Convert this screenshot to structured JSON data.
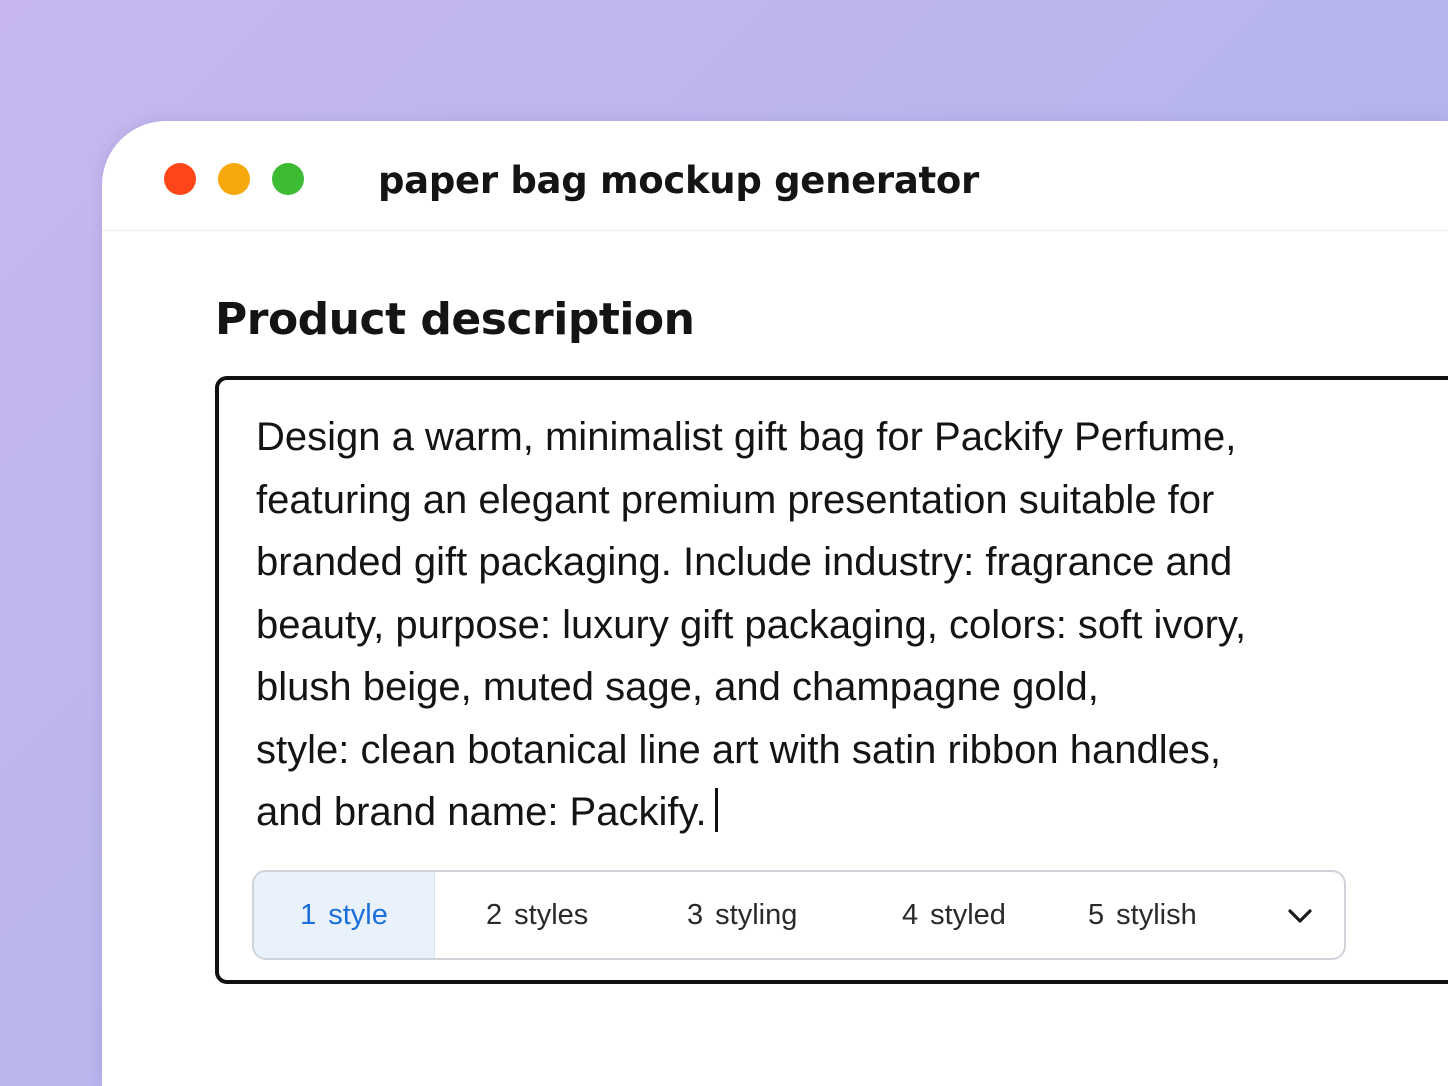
{
  "window": {
    "title": "paper bag mockup generator",
    "controls": {
      "close_color": "#ff4618",
      "minimize_color": "#f7a90c",
      "maximize_color": "#3dbb34"
    }
  },
  "section": {
    "heading": "Product description"
  },
  "editor": {
    "lines": [
      "Design a warm, minimalist gift bag for Packify Perfume,",
      "featuring an elegant premium presentation suitable for",
      "branded gift packaging. Include industry: fragrance and",
      "beauty, purpose: luxury gift packaging, colors: soft ivory,",
      "blush beige, muted sage, and champagne gold,",
      "style: clean botanical line art with satin ribbon handles,",
      "and brand name: Packify."
    ]
  },
  "suggestions": {
    "items": [
      {
        "num": "1",
        "label": "style",
        "selected": true
      },
      {
        "num": "2",
        "label": "styles",
        "selected": false
      },
      {
        "num": "3",
        "label": "styling",
        "selected": false
      },
      {
        "num": "4",
        "label": "styled",
        "selected": false
      },
      {
        "num": "5",
        "label": "stylish",
        "selected": false
      }
    ],
    "expand_icon": "chevron-down-icon",
    "selected_color": "#1a6fd8",
    "selected_background": "#e9f1fb"
  }
}
